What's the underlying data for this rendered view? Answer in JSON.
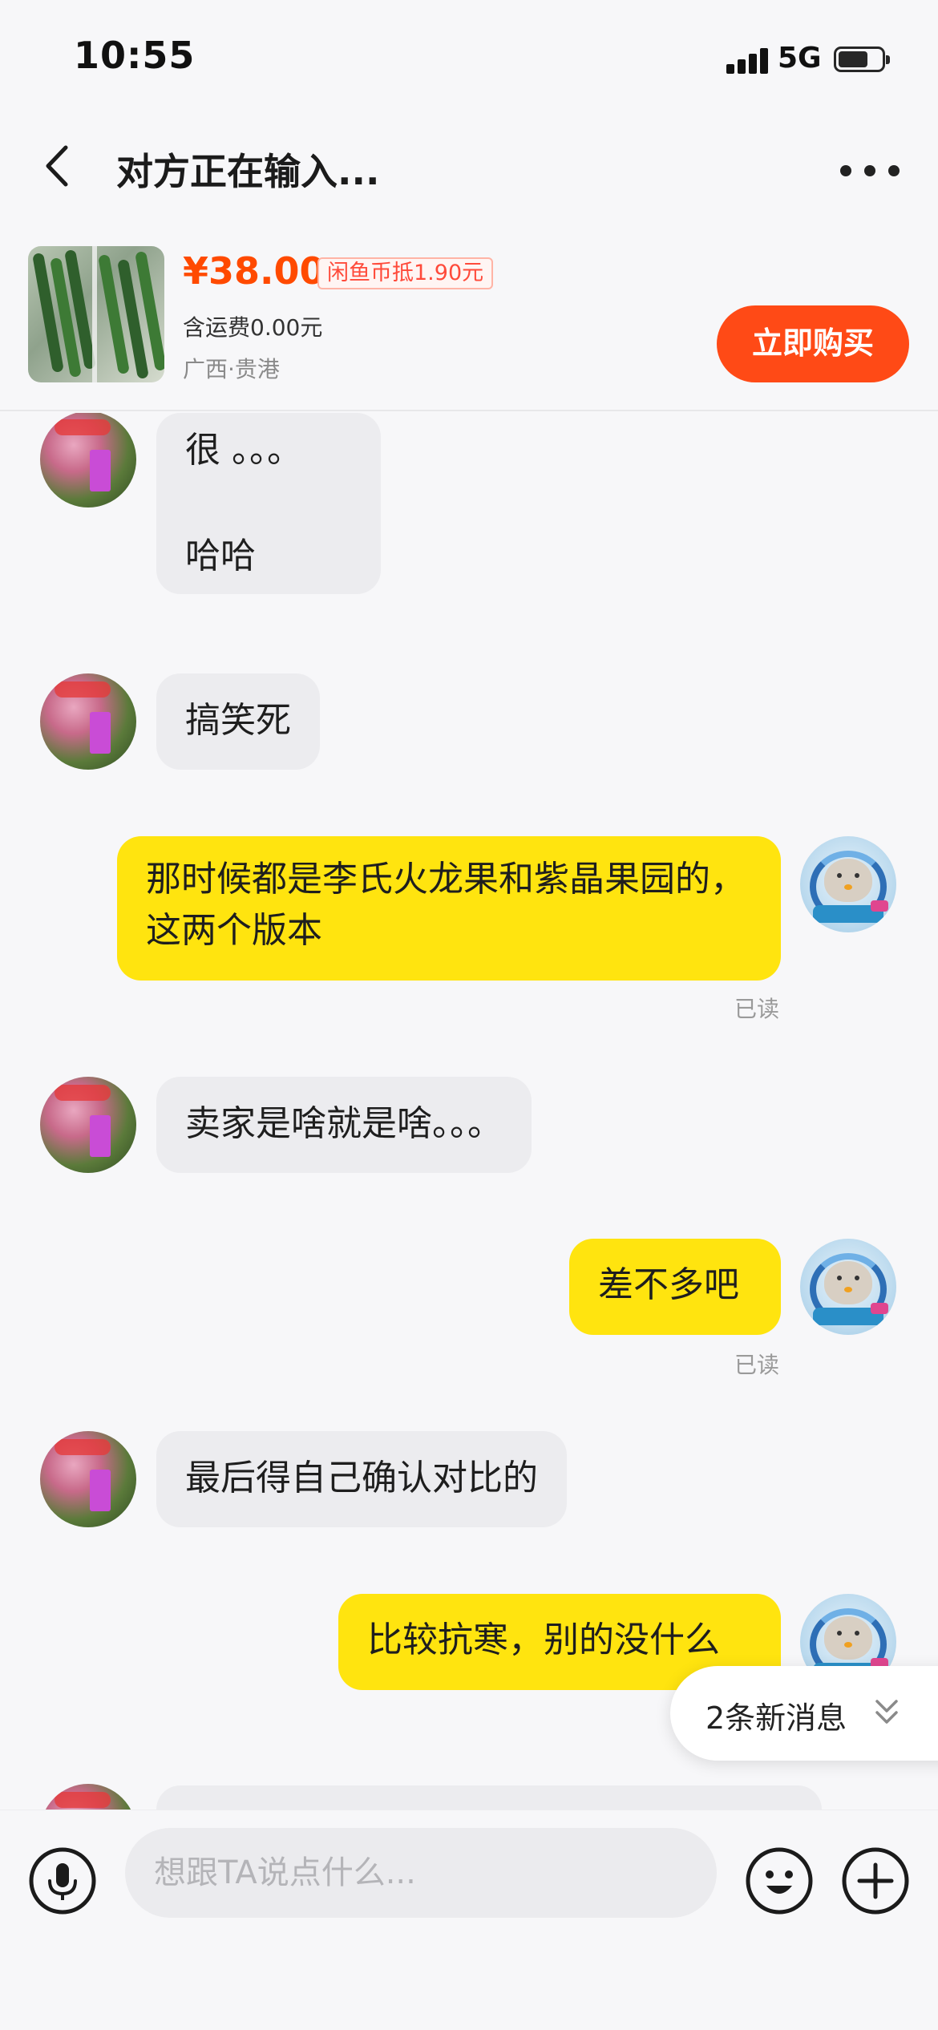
{
  "status_bar": {
    "time": "10:55",
    "network": "5G",
    "battery_level": 0.7
  },
  "header": {
    "title": "对方正在输入..."
  },
  "product": {
    "price": "¥38.00",
    "coin_discount": "闲鱼币抵1.90元",
    "shipping": "含运费0.00元",
    "location": "广西·贵港",
    "buy_label": "立即购买"
  },
  "messages": [
    {
      "from": "other",
      "text": "很 。。。\n\n哈哈"
    },
    {
      "from": "other",
      "text": "搞笑死"
    },
    {
      "from": "self",
      "text": "那时候都是李氏火龙果和紫晶果园的，这两个版本",
      "status": "已读"
    },
    {
      "from": "other",
      "text": "卖家是啥就是啥。。。"
    },
    {
      "from": "self",
      "text": "差不多吧",
      "status": "已读"
    },
    {
      "from": "other",
      "text": "最后得自己确认对比的"
    },
    {
      "from": "self",
      "text": "比较抗寒，别的没什么"
    }
  ],
  "new_messages_label": "2条新消息",
  "input": {
    "placeholder": "想跟TA说点什么..."
  },
  "colors": {
    "accent": "#ff4a16",
    "self_bubble": "#ffe40f",
    "other_bubble": "#ececef",
    "price": "#ff4a00"
  },
  "icons": [
    "back-icon",
    "more-icon",
    "mic-icon",
    "emoji-icon",
    "plus-icon",
    "chevron-down-icon"
  ]
}
